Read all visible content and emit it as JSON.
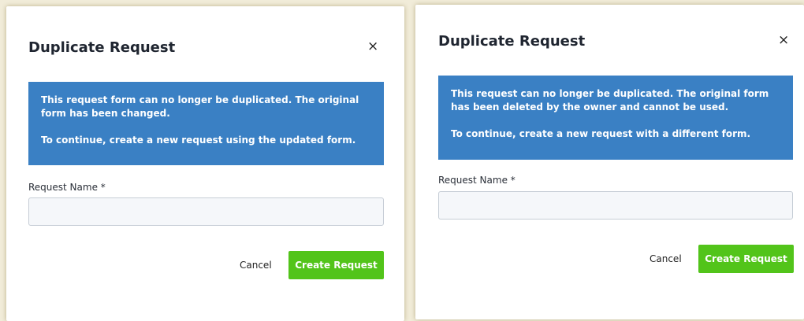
{
  "dialogs": [
    {
      "title": "Duplicate Request",
      "close_symbol": "×",
      "alert": {
        "line1": "This request form can no longer be duplicated. The original form has been changed.",
        "line2": "To continue, create a new request using the updated form."
      },
      "field": {
        "label": "Request Name *",
        "value": "",
        "placeholder": ""
      },
      "cancel_label": "Cancel",
      "create_label": "Create Request"
    },
    {
      "title": "Duplicate Request",
      "close_symbol": "×",
      "alert": {
        "line1": "This request can no longer be duplicated. The original form has been deleted by the owner and cannot be used.",
        "line2": "To continue, create a new request with a different form."
      },
      "field": {
        "label": "Request Name *",
        "value": "",
        "placeholder": ""
      },
      "cancel_label": "Cancel",
      "create_label": "Create Request"
    }
  ],
  "colors": {
    "background": "#f1ecd9",
    "alert_bg": "#3a80c4",
    "primary_button": "#52c41a",
    "title_text": "#1f2530"
  },
  "icons": {
    "close": "close-icon"
  }
}
